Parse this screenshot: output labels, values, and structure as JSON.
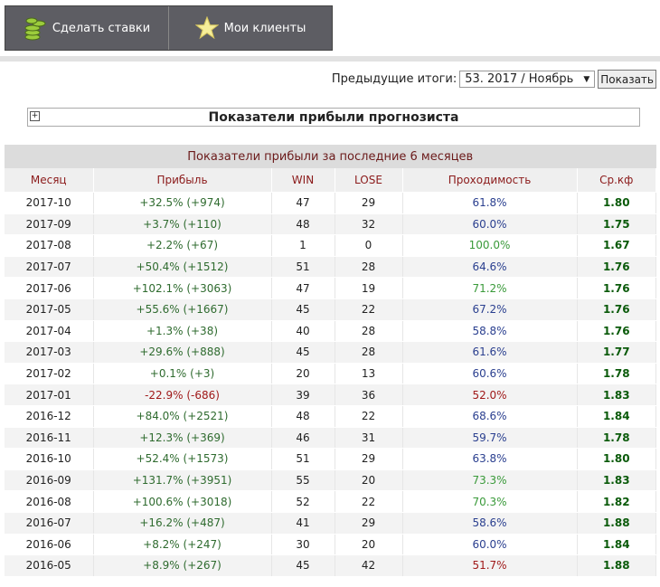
{
  "nav": {
    "make_bets": "Сделать ставки",
    "my_clients": "Мои клиенты"
  },
  "previous": {
    "label": "Предыдущие итоги:",
    "selected": "53. 2017 / Ноябрь",
    "show": "Показать"
  },
  "section_title": "Показатели прибыли прогнозиста",
  "table": {
    "title": "Показатели прибыли за последние 6 месяцев",
    "headers": [
      "Месяц",
      "Прибыль",
      "WIN",
      "LOSE",
      "Проходимость",
      "Ср.кф"
    ],
    "rows": [
      {
        "month": "2017-10",
        "profit": "+32.5% (+974)",
        "sign": "pos",
        "win": "47",
        "lose": "29",
        "rate": "61.8%",
        "tone": "blue",
        "coef": "1.80"
      },
      {
        "month": "2017-09",
        "profit": "+3.7% (+110)",
        "sign": "pos",
        "win": "48",
        "lose": "32",
        "rate": "60.0%",
        "tone": "blue",
        "coef": "1.75"
      },
      {
        "month": "2017-08",
        "profit": "+2.2% (+67)",
        "sign": "pos",
        "win": "1",
        "lose": "0",
        "rate": "100.0%",
        "tone": "green",
        "coef": "1.67"
      },
      {
        "month": "2017-07",
        "profit": "+50.4% (+1512)",
        "sign": "pos",
        "win": "51",
        "lose": "28",
        "rate": "64.6%",
        "tone": "blue",
        "coef": "1.76"
      },
      {
        "month": "2017-06",
        "profit": "+102.1% (+3063)",
        "sign": "pos",
        "win": "47",
        "lose": "19",
        "rate": "71.2%",
        "tone": "green",
        "coef": "1.76"
      },
      {
        "month": "2017-05",
        "profit": "+55.6% (+1667)",
        "sign": "pos",
        "win": "45",
        "lose": "22",
        "rate": "67.2%",
        "tone": "blue",
        "coef": "1.76"
      },
      {
        "month": "2017-04",
        "profit": "+1.3% (+38)",
        "sign": "pos",
        "win": "40",
        "lose": "28",
        "rate": "58.8%",
        "tone": "blue",
        "coef": "1.76"
      },
      {
        "month": "2017-03",
        "profit": "+29.6% (+888)",
        "sign": "pos",
        "win": "45",
        "lose": "28",
        "rate": "61.6%",
        "tone": "blue",
        "coef": "1.77"
      },
      {
        "month": "2017-02",
        "profit": "+0.1% (+3)",
        "sign": "pos",
        "win": "20",
        "lose": "13",
        "rate": "60.6%",
        "tone": "blue",
        "coef": "1.78"
      },
      {
        "month": "2017-01",
        "profit": "-22.9% (-686)",
        "sign": "neg",
        "win": "39",
        "lose": "36",
        "rate": "52.0%",
        "tone": "red",
        "coef": "1.83"
      },
      {
        "month": "2016-12",
        "profit": "+84.0% (+2521)",
        "sign": "pos",
        "win": "48",
        "lose": "22",
        "rate": "68.6%",
        "tone": "blue",
        "coef": "1.84"
      },
      {
        "month": "2016-11",
        "profit": "+12.3% (+369)",
        "sign": "pos",
        "win": "46",
        "lose": "31",
        "rate": "59.7%",
        "tone": "blue",
        "coef": "1.78"
      },
      {
        "month": "2016-10",
        "profit": "+52.4% (+1573)",
        "sign": "pos",
        "win": "51",
        "lose": "29",
        "rate": "63.8%",
        "tone": "blue",
        "coef": "1.80"
      },
      {
        "month": "2016-09",
        "profit": "+131.7% (+3951)",
        "sign": "pos",
        "win": "55",
        "lose": "20",
        "rate": "73.3%",
        "tone": "green",
        "coef": "1.83"
      },
      {
        "month": "2016-08",
        "profit": "+100.6% (+3018)",
        "sign": "pos",
        "win": "52",
        "lose": "22",
        "rate": "70.3%",
        "tone": "green",
        "coef": "1.82"
      },
      {
        "month": "2016-07",
        "profit": "+16.2% (+487)",
        "sign": "pos",
        "win": "41",
        "lose": "29",
        "rate": "58.6%",
        "tone": "blue",
        "coef": "1.88"
      },
      {
        "month": "2016-06",
        "profit": "+8.2% (+247)",
        "sign": "pos",
        "win": "30",
        "lose": "20",
        "rate": "60.0%",
        "tone": "blue",
        "coef": "1.84"
      },
      {
        "month": "2016-05",
        "profit": "+8.9% (+267)",
        "sign": "pos",
        "win": "45",
        "lose": "42",
        "rate": "51.7%",
        "tone": "red",
        "coef": "1.88"
      }
    ]
  }
}
